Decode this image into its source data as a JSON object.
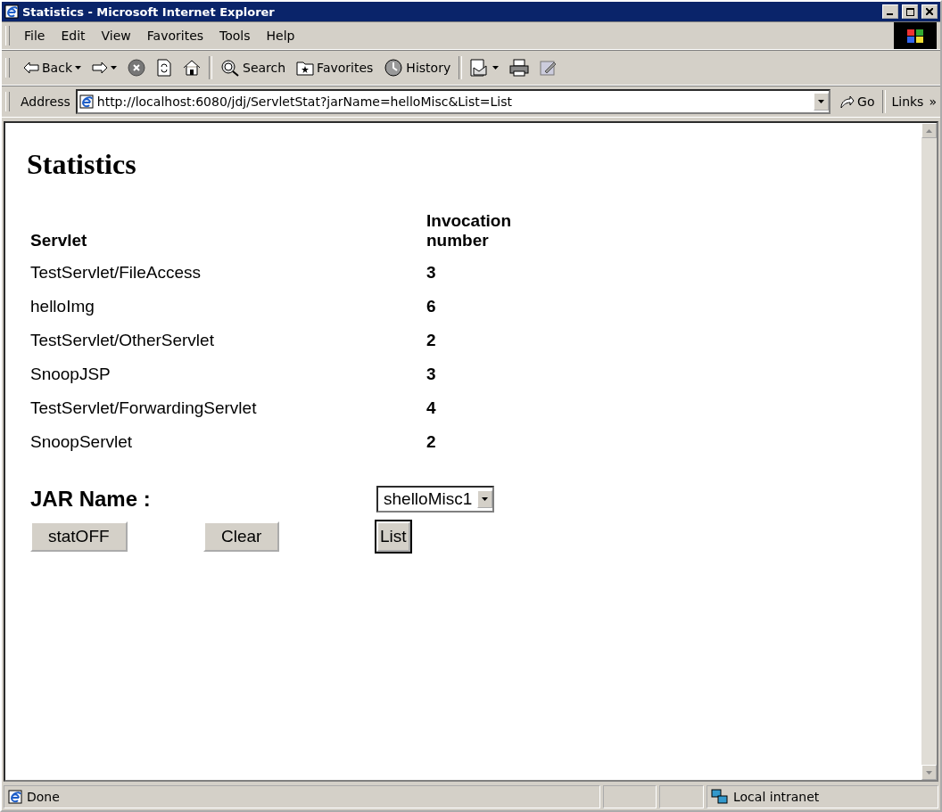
{
  "window": {
    "title": "Statistics - Microsoft Internet Explorer",
    "controls": [
      {
        "kind": "minimize"
      },
      {
        "kind": "maximize"
      },
      {
        "kind": "close"
      }
    ]
  },
  "menu": [
    "File",
    "Edit",
    "View",
    "Favorites",
    "Tools",
    "Help"
  ],
  "toolbar": [
    {
      "kind": "back",
      "label": "Back",
      "dropdown": true
    },
    {
      "kind": "forward",
      "dropdown": true
    },
    {
      "kind": "stop",
      "dropdown": false
    },
    {
      "kind": "refresh",
      "dropdown": false
    },
    {
      "kind": "home",
      "dropdown": false
    },
    {
      "kind": "sep"
    },
    {
      "kind": "search",
      "label": "Search",
      "dropdown": false
    },
    {
      "kind": "favorites",
      "label": "Favorites",
      "dropdown": false
    },
    {
      "kind": "history",
      "label": "History",
      "dropdown": false
    },
    {
      "kind": "sep"
    },
    {
      "kind": "mail",
      "dropdown": true
    },
    {
      "kind": "print",
      "dropdown": false
    },
    {
      "kind": "edit",
      "dropdown": false
    }
  ],
  "address": {
    "label": "Address",
    "value": "http://localhost:6080/jdj/ServletStat?jarName=helloMisc&List=List",
    "go": "Go",
    "links": "Links",
    "more": "»"
  },
  "page": {
    "heading": "Statistics",
    "columns": [
      "Servlet",
      "Invocation number"
    ],
    "rows": [
      {
        "servlet": "TestServlet/FileAccess",
        "count": "3"
      },
      {
        "servlet": "helloImg",
        "count": "6"
      },
      {
        "servlet": "TestServlet/OtherServlet",
        "count": "2"
      },
      {
        "servlet": "SnoopJSP",
        "count": "3"
      },
      {
        "servlet": "TestServlet/ForwardingServlet",
        "count": "4"
      },
      {
        "servlet": "SnoopServlet",
        "count": "2"
      }
    ],
    "jar_label": "JAR Name :",
    "jar_select": "shelloMisc1",
    "buttons": [
      {
        "label": "statOFF",
        "focused": false
      },
      {
        "label": "Clear",
        "focused": false
      },
      {
        "label": "List",
        "focused": true
      }
    ]
  },
  "status": {
    "text": "Done",
    "zone": "Local intranet"
  }
}
